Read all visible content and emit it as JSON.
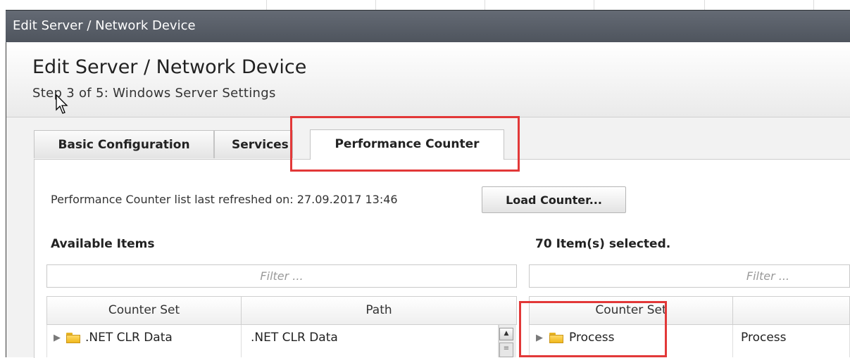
{
  "window": {
    "title": "Edit Server / Network Device"
  },
  "header": {
    "title": "Edit Server / Network Device",
    "step": "Step 3 of 5: Windows Server Settings"
  },
  "tabs": [
    {
      "label": "Basic Configuration",
      "active": false
    },
    {
      "label": "Services",
      "active": false
    },
    {
      "label": "Performance Counter",
      "active": true
    }
  ],
  "refresh": {
    "text": "Performance Counter list last refreshed on: 27.09.2017 13:46",
    "button_label": "Load Counter..."
  },
  "available": {
    "label": "Available Items",
    "filter_placeholder": "Filter ...",
    "columns": [
      "Counter Set",
      "Path"
    ],
    "rows": [
      {
        "counter_set": ".NET CLR Data",
        "path": ".NET CLR Data"
      }
    ]
  },
  "selected": {
    "label": "70 Item(s) selected.",
    "filter_placeholder": "Filter ...",
    "columns": [
      "Counter Set"
    ],
    "rows": [
      {
        "counter_set": "Process",
        "path": "Process"
      }
    ]
  },
  "colors": {
    "titlebar": "#5a6069",
    "highlight_box": "#e23838",
    "folder": "#f0b81d"
  },
  "icons": {
    "expand": "triangle-right",
    "folder": "folder-icon",
    "cursor": "mouse-pointer"
  }
}
